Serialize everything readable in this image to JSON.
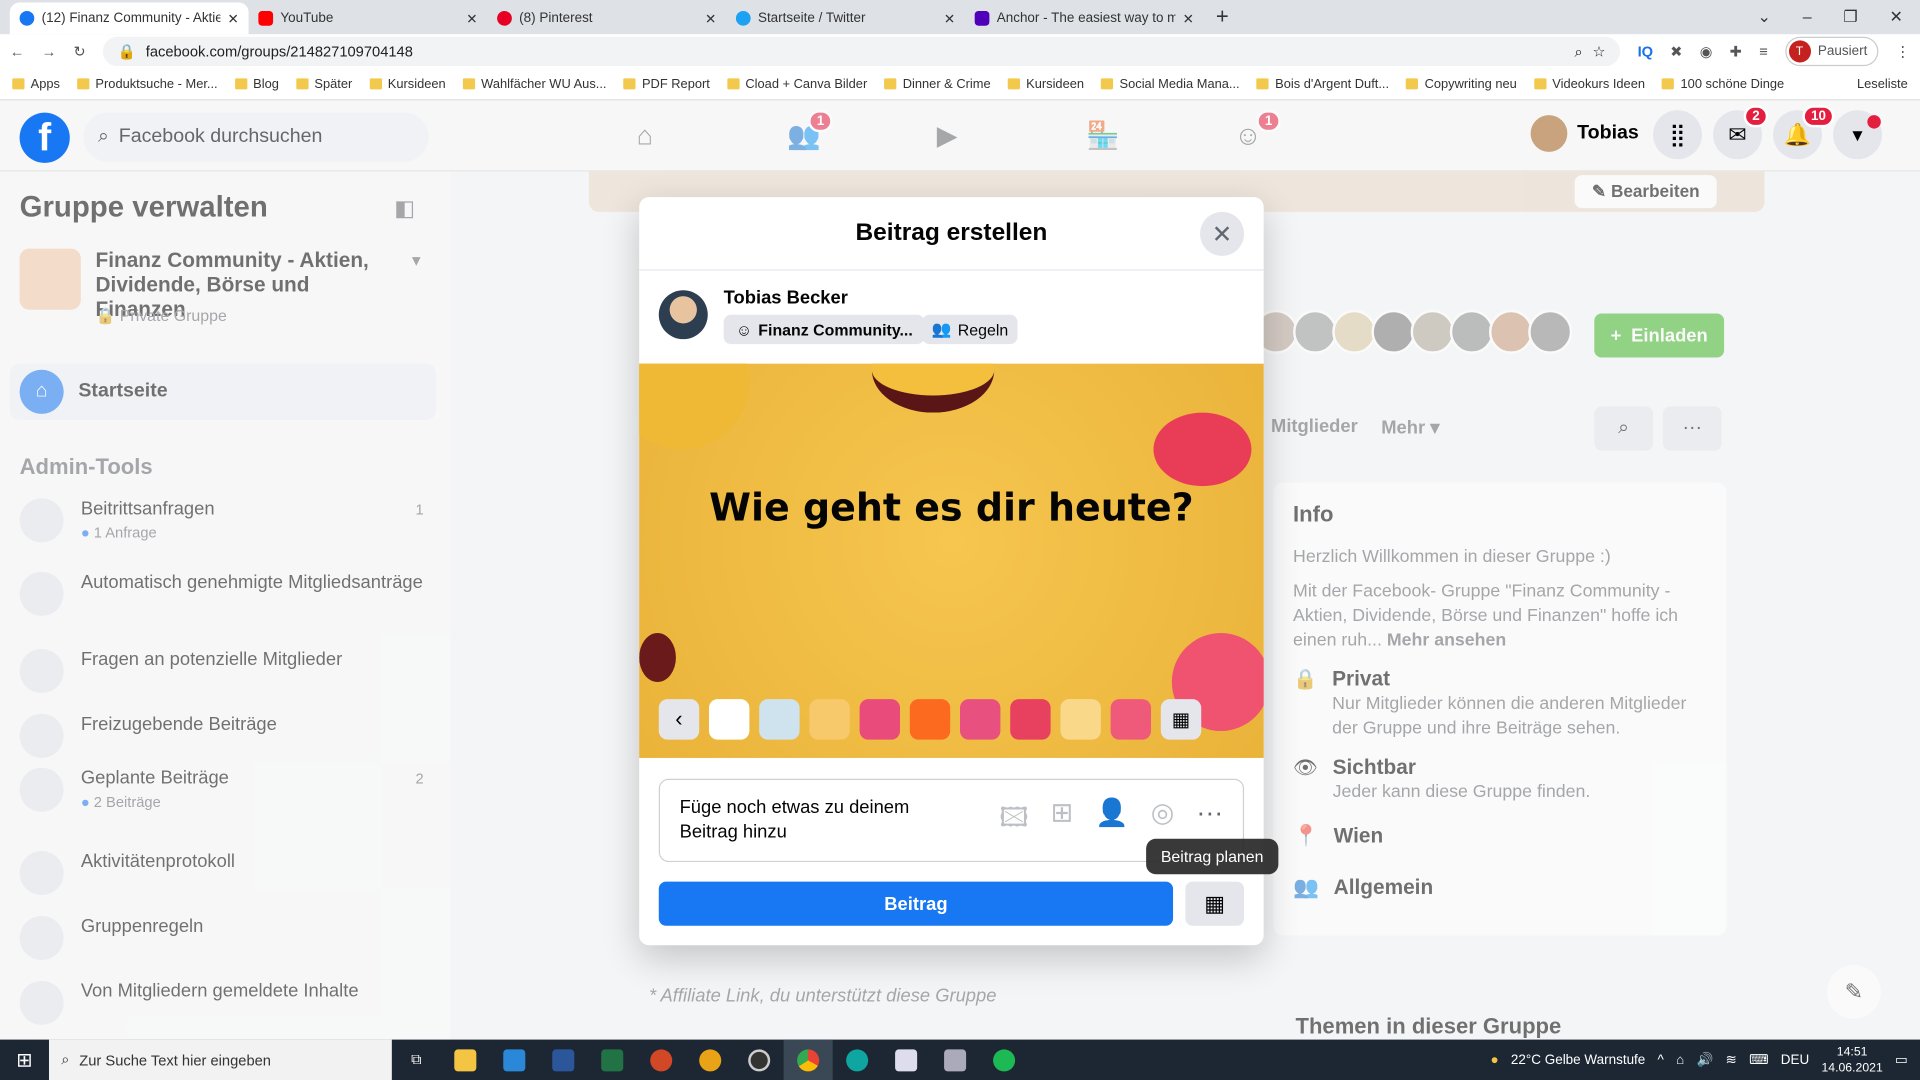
{
  "browser": {
    "tabs": [
      {
        "title": "(12) Finanz Community - Aktien",
        "color": "#1877f2"
      },
      {
        "title": "YouTube",
        "color": "#ff0000"
      },
      {
        "title": "(8) Pinterest",
        "color": "#e60023"
      },
      {
        "title": "Startseite / Twitter",
        "color": "#1da1f2"
      },
      {
        "title": "Anchor - The easiest way to mak",
        "color": "#5000b9"
      }
    ],
    "url": "facebook.com/groups/214827109704148",
    "profile_label": "Pausiert",
    "profile_initial": "T",
    "bookmarks": [
      "Apps",
      "Produktsuche - Mer...",
      "Blog",
      "Später",
      "Kursideen",
      "Wahlfächer WU Aus...",
      "PDF Report",
      "Cload + Canva Bilder",
      "Dinner & Crime",
      "Kursideen",
      "Social Media Mana...",
      "Bois d'Argent Duft...",
      "Copywriting neu",
      "Videokurs Ideen",
      "100 schöne Dinge"
    ],
    "reading_list": "Leseliste"
  },
  "header": {
    "search_placeholder": "Facebook durchsuchen",
    "user_name": "Tobias",
    "friends_badge": "1",
    "groups_badge": "1",
    "messenger_badge": "2",
    "notifications_badge": "10"
  },
  "sidebar": {
    "title": "Gruppe verwalten",
    "group_name": "Finanz Community - Aktien, Dividende, Börse und Finanzen",
    "group_privacy": "Private Gruppe",
    "home": "Startseite",
    "admin_title": "Admin-Tools",
    "items": [
      {
        "label": "Beitrittsanfragen",
        "sub": "1 Anfrage",
        "count": "1"
      },
      {
        "label": "Automatisch genehmigte Mitgliedsanträge"
      },
      {
        "label": "Fragen an potenzielle Mitglieder"
      },
      {
        "label": "Freizugebende Beiträge"
      },
      {
        "label": "Geplante Beiträge",
        "sub": "2 Beiträge",
        "count": "2"
      },
      {
        "label": "Aktivitätenprotokoll"
      },
      {
        "label": "Gruppenregeln"
      },
      {
        "label": "Von Mitgliedern gemeldete Inhalte"
      }
    ]
  },
  "main": {
    "edit_button": "Bearbeiten",
    "invite_button": "Einladen",
    "tab_members": "Mitglieder",
    "tab_more": "Mehr",
    "info_title": "Info",
    "info_welcome": "Herzlich Willkommen in dieser Gruppe :)",
    "info_desc": "Mit der Facebook- Gruppe \"Finanz Community - Aktien, Dividende, Börse und Finanzen\" hoffe ich einen ruh...",
    "info_more": "Mehr ansehen",
    "private_title": "Privat",
    "private_desc": "Nur Mitglieder können die anderen Mitglieder der Gruppe und ihre Beiträge sehen.",
    "visible_title": "Sichtbar",
    "visible_desc": "Jeder kann diese Gruppe finden.",
    "location": "Wien",
    "category": "Allgemein",
    "topics_title": "Themen in dieser Gruppe",
    "affiliate_note": "* Affiliate Link, du unterstützt diese Gruppe"
  },
  "modal": {
    "title": "Beitrag erstellen",
    "author": "Tobias Becker",
    "audience": "Finanz Community...",
    "rules": "Regeln",
    "post_text": "Wie geht es dir heute?",
    "background_colors": [
      "#ffffff",
      "#cfe3ee",
      "#f7c96a",
      "#e94b7b",
      "#fb6a1f",
      "#e8507f",
      "#e8405f",
      "#f9d88a",
      "#f05a7a"
    ],
    "add_to_post": "Füge noch etwas zu deinem Beitrag hinzu",
    "post_button": "Beitrag",
    "tooltip": "Beitrag planen",
    "accent": "#1877f2"
  },
  "taskbar": {
    "search_placeholder": "Zur Suche Text hier eingeben",
    "weather": "22°C  Gelbe Warnstufe",
    "language": "DEU",
    "time": "14:51",
    "date": "14.06.2021"
  }
}
